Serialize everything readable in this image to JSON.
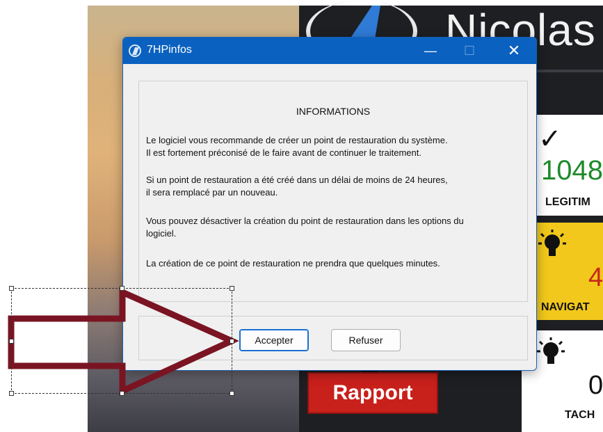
{
  "background_app": {
    "username": "Nicolas",
    "tiles": [
      {
        "value": "1048",
        "label": "LEGITIM",
        "value_color": "#1e8a2c"
      },
      {
        "value": "4",
        "label": "NAVIGAT",
        "value_color": "#c8261b"
      },
      {
        "value": "0",
        "label": "TACH",
        "value_color": "#111111"
      }
    ],
    "rapport_label": "Rapport"
  },
  "dialog": {
    "title": "7HPinfos",
    "controls": {
      "minimize": "—",
      "maximize": "☐",
      "close": "✕"
    },
    "heading": "INFORMATIONS",
    "paragraphs": [
      [
        "Le logiciel vous recommande de créer un point de restauration du système.",
        "Il est fortement préconisé de le faire avant de continuer le traitement."
      ],
      [
        "Si un point de restauration a été créé dans un délai de moins de 24 heures,",
        "il sera remplacé par un nouveau."
      ],
      [
        "Vous pouvez désactiver la création du point de restauration dans les options du",
        "logiciel."
      ],
      [
        "La création de ce point de restauration ne prendra que quelques minutes."
      ]
    ],
    "buttons": {
      "accept": "Accepter",
      "refuse": "Refuser"
    }
  },
  "annotation": {
    "arrow_color": "#7a1422",
    "icon": "right-arrow-icon"
  }
}
